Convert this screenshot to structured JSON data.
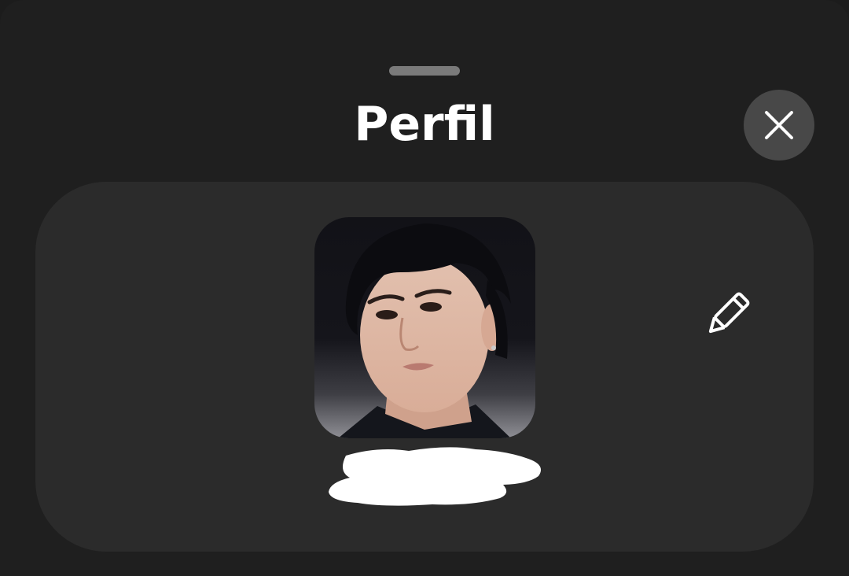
{
  "sheet": {
    "title": "Perfil"
  },
  "icons": {
    "close": "close-icon",
    "edit": "pencil-icon"
  },
  "colors": {
    "background": "#1f1f1f",
    "card": "#2b2b2b",
    "close_button": "#484848",
    "text": "#ffffff"
  }
}
